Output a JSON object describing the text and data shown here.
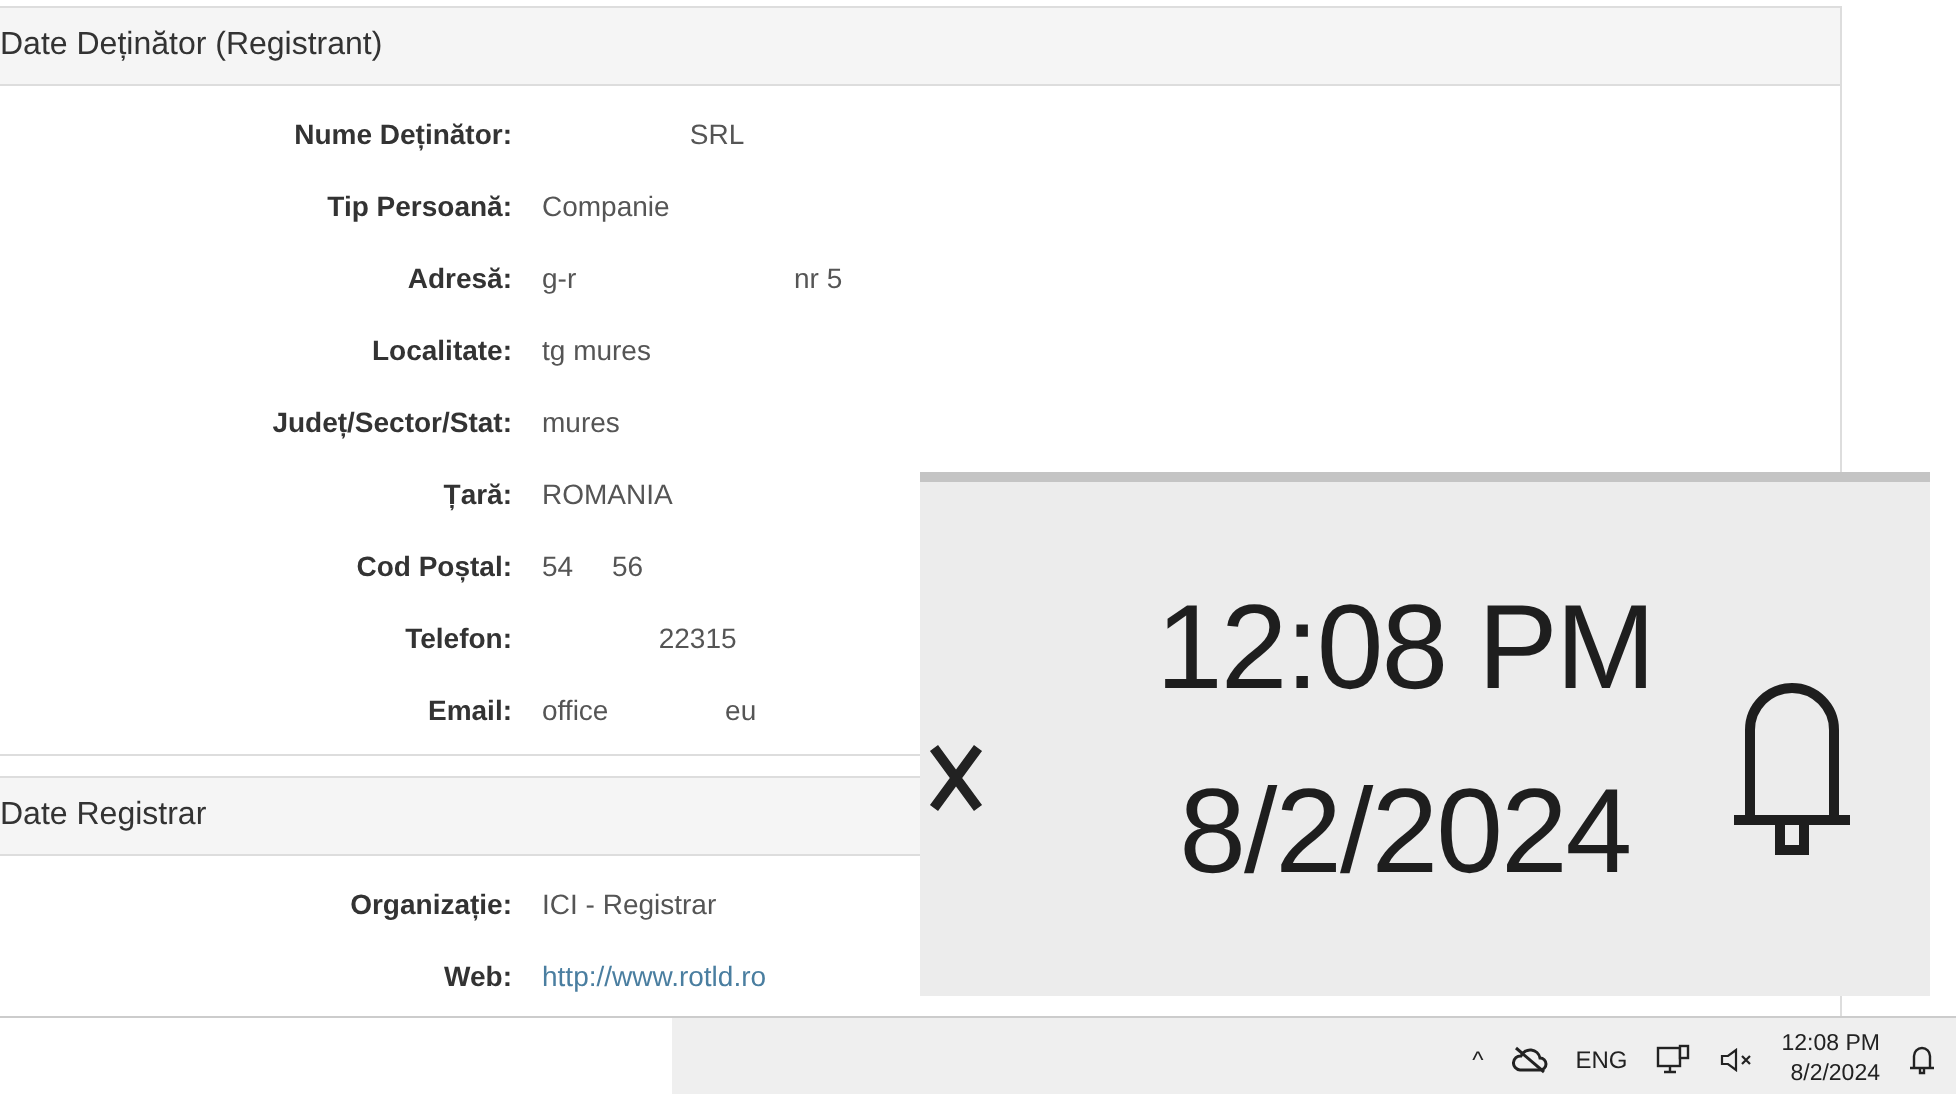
{
  "sections": [
    {
      "title": "Date Deținător (Registrant)",
      "fields": [
        {
          "label": "Nume Deținător:",
          "value": "                   SRL"
        },
        {
          "label": "Tip Persoană:",
          "value": "Companie"
        },
        {
          "label": "Adresă:",
          "value": "g-r                            nr 5"
        },
        {
          "label": "Localitate:",
          "value": "tg mures"
        },
        {
          "label": "Județ/Sector/Stat:",
          "value": "mures"
        },
        {
          "label": "Țară:",
          "value": "ROMANIA"
        },
        {
          "label": "Cod Poștal:",
          "value": "54     56"
        },
        {
          "label": "Telefon:",
          "value": "               22315"
        },
        {
          "label": "Email:",
          "value": "office               eu"
        }
      ]
    },
    {
      "title": "Date Registrar",
      "fields": [
        {
          "label": "Organizație:",
          "value": "ICI - Registrar"
        },
        {
          "label": "Web:",
          "kind": "link",
          "value": "http://www.rotld.ro"
        }
      ]
    }
  ],
  "taskbar": {
    "chevron": "^",
    "language": "ENG",
    "time": "12:08 PM",
    "date": "8/2/2024"
  },
  "inset": {
    "time": "12:08 PM",
    "date": "8/2/2024"
  }
}
